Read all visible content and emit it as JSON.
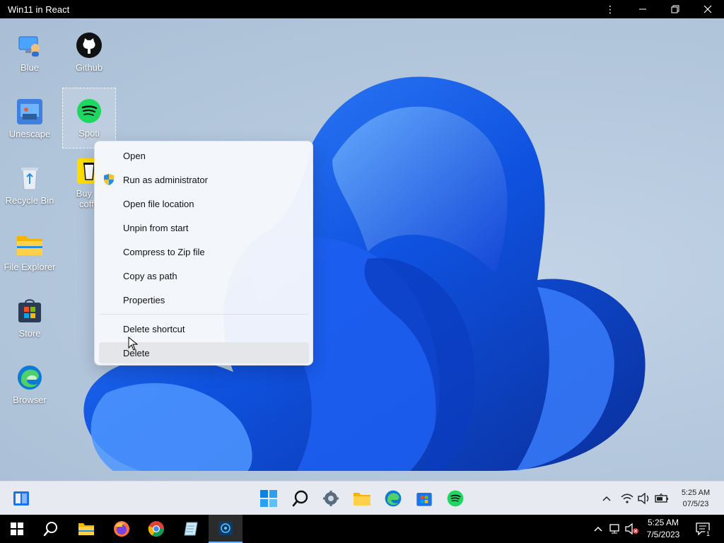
{
  "window": {
    "title": "Win11 in React"
  },
  "desktop_icons": [
    {
      "name": "blue",
      "label": "Blue"
    },
    {
      "name": "github",
      "label": "Github"
    },
    {
      "name": "unescape",
      "label": "Unescape"
    },
    {
      "name": "spotify",
      "label": "Spoti"
    },
    {
      "name": "recycle-bin",
      "label": "Recycle Bin"
    },
    {
      "name": "buy-me-coffee",
      "label": "Buy m\ncoffe"
    },
    {
      "name": "file-explorer",
      "label": "File Explorer"
    },
    {
      "name": "store",
      "label": "Store"
    },
    {
      "name": "browser",
      "label": "Browser"
    }
  ],
  "context_menu": {
    "items": [
      {
        "label": "Open"
      },
      {
        "label": "Run as administrator",
        "icon": "shield-icon"
      },
      {
        "label": "Open file location"
      },
      {
        "label": "Unpin from start"
      },
      {
        "label": "Compress to Zip file"
      },
      {
        "label": "Copy as path"
      },
      {
        "label": "Properties"
      },
      {
        "label": "Delete shortcut"
      },
      {
        "label": "Delete",
        "hovered": true
      }
    ]
  },
  "taskbar": {
    "apps": [
      "start-icon",
      "search-icon",
      "settings-icon",
      "file-explorer-icon",
      "edge-icon",
      "store-icon",
      "spotify-icon"
    ],
    "tray": [
      "chevron-up-icon",
      "wifi-icon",
      "volume-icon",
      "battery-icon"
    ],
    "time": "5:25 AM",
    "date": "07/5/23"
  },
  "host_taskbar": {
    "apps": [
      "windows-start-icon",
      "search-icon",
      "file-explorer-icon",
      "firefox-icon",
      "chrome-icon",
      "notepad-icon",
      "emulator-app-icon"
    ],
    "time": "5:25 AM",
    "date": "7/5/2023",
    "notification_count": "1"
  },
  "colors": {
    "accent": "#0067c0",
    "bloom": "#1a5cff",
    "spotify": "#1ed760"
  }
}
